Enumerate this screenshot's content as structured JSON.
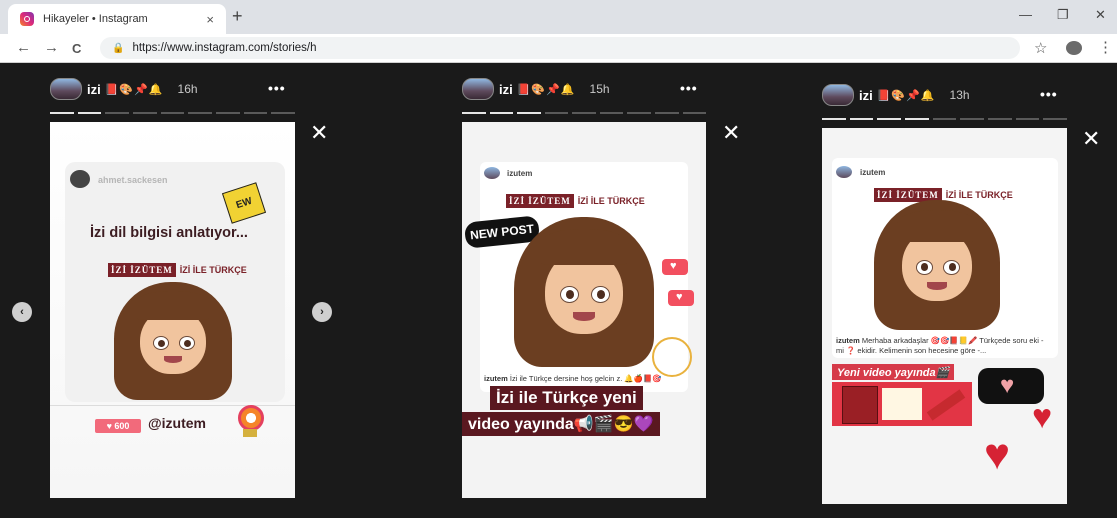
{
  "browser": {
    "tab_title": "Hikayeler • Instagram",
    "tab_close": "×",
    "new_tab": "+",
    "url": "https://www.instagram.com/stories/h",
    "lock_icon": "🔒",
    "back": "←",
    "forward": "→",
    "reload": "C",
    "star": "☆",
    "menu": "⋮",
    "minimize": "—",
    "maximize": "❐",
    "close": "✕"
  },
  "stories": [
    {
      "username": "izi",
      "emojis": "📕🎨📌🔔",
      "age": "16h",
      "more": "•••",
      "close": "✕",
      "progress_total": 9,
      "progress_done": 2,
      "card_user": "ahmet.sackesen",
      "ew": "EW",
      "headline": "İzi dil bilgisi anlatıyor...",
      "brand_box": "İZİ İZÜTEM",
      "brand_text": "İZİ İLE TÜRKÇE",
      "likes": "♥ 600",
      "handle": "@izutem"
    },
    {
      "username": "izi",
      "emojis": "📕🎨📌🔔",
      "age": "15h",
      "more": "•••",
      "close": "✕",
      "progress_total": 9,
      "progress_done": 3,
      "card_user": "izutem",
      "brand_box": "İZİ İZÜTEM",
      "brand_text": "İZİ İLE TÜRKÇE",
      "new_post": "NEW POST",
      "caption_user": "izutem",
      "caption": "İzi ile Türkçe dersine hoş gelcin z. 🔔🍎📕🎯",
      "banner_line1": "İzi ile Türkçe yeni",
      "banner_line2": "video yayında📢🎬😎💜"
    },
    {
      "username": "izi",
      "emojis": "📕🎨📌🔔",
      "age": "13h",
      "more": "•••",
      "close": "✕",
      "progress_total": 9,
      "progress_done": 4,
      "card_user": "izutem",
      "brand_box": "İZİ İZÜTEM",
      "brand_text": "İZİ İLE TÜRKÇE",
      "caption_user": "izutem",
      "caption": "Merhaba arkadaşlar 🎯🎯📕📒🖍️ Türkçede soru eki -mi ❓ ekidir. Kelimenin son hecesine göre -...",
      "video_tag": "Yeni video yayında🎬"
    }
  ],
  "nav": {
    "prev": "‹",
    "next": "›"
  }
}
